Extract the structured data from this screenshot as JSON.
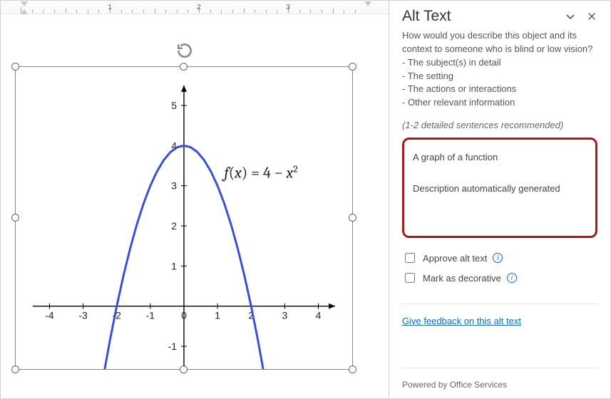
{
  "ruler": {
    "numbers": [
      "1",
      "2",
      "3"
    ]
  },
  "panel": {
    "title": "Alt Text",
    "desc_lines": [
      "How would you describe this object and its context to someone who is blind or low vision?",
      "- The subject(s) in detail",
      "- The setting",
      "- The actions or interactions",
      "- Other relevant information"
    ],
    "recommended": "(1-2 detailed sentences recommended)",
    "alt_text_value": "A graph of a function\n\nDescription automatically generated",
    "approve_label": "Approve alt text",
    "decorative_label": "Mark as decorative",
    "feedback_link": "Give feedback on this alt text",
    "footer": "Powered by Office Services"
  },
  "chart_data": {
    "type": "line",
    "title": "",
    "equation_label": "f(x) = 4 − x²",
    "xlabel": "",
    "ylabel": "",
    "xlim": [
      -4.5,
      4.5
    ],
    "ylim": [
      -1.5,
      5.5
    ],
    "xticks": [
      -4,
      -3,
      -2,
      -1,
      0,
      1,
      2,
      3,
      4
    ],
    "yticks": [
      -1,
      1,
      2,
      3,
      4,
      5
    ],
    "series": [
      {
        "name": "f(x)=4-x^2",
        "x": [
          -2.4,
          -2.2,
          -2.0,
          -1.8,
          -1.6,
          -1.4,
          -1.2,
          -1.0,
          -0.8,
          -0.6,
          -0.4,
          -0.2,
          0,
          0.2,
          0.4,
          0.6,
          0.8,
          1.0,
          1.2,
          1.4,
          1.6,
          1.8,
          2.0,
          2.2,
          2.4
        ],
        "y": [
          -1.76,
          -0.84,
          0,
          0.76,
          1.44,
          2.04,
          2.56,
          3.0,
          3.36,
          3.64,
          3.84,
          3.96,
          4.0,
          3.96,
          3.84,
          3.64,
          3.36,
          3.0,
          2.56,
          2.04,
          1.44,
          0.76,
          0,
          -0.84,
          -1.76
        ]
      }
    ]
  }
}
